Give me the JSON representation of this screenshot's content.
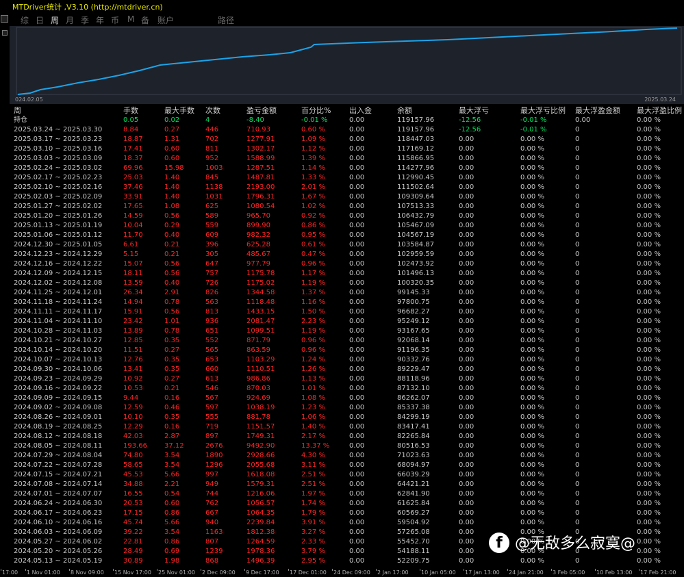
{
  "app": {
    "title": "MTDriver统计 ,V3.10 (http://mtdriver.cn)"
  },
  "tabs": [
    {
      "label": "综"
    },
    {
      "label": "日"
    },
    {
      "label": "周",
      "active": true
    },
    {
      "label": "月"
    },
    {
      "label": "季"
    },
    {
      "label": "年"
    },
    {
      "label": "币"
    },
    {
      "label": "M"
    },
    {
      "label": "备"
    },
    {
      "label": "账户"
    },
    {
      "label": "路径"
    }
  ],
  "chart": {
    "start_label": "024.02.05",
    "end_label": "2025.03.24",
    "line_color": "#1ca3e8",
    "background": "#1e222b"
  },
  "colors": {
    "green": "#00e060",
    "red": "#ff2424",
    "header": "#d0d0d0",
    "text": "#c8c8c8"
  },
  "table": {
    "headers": [
      "周",
      "手数",
      "最大手数",
      "次数",
      "盈亏金额",
      "百分比%",
      "出入金",
      "余额",
      "最大浮亏",
      "最大浮亏比例",
      "最大浮盈金额",
      "最大浮盈比例"
    ],
    "position_row": [
      "持仓",
      "0.05",
      "0.02",
      "4",
      "-8.40",
      "-0.01 %",
      "0.00",
      "119157.96",
      "-12.56",
      "-0.01 %",
      "0.00",
      "0.00 %"
    ],
    "rows": [
      [
        "2025.03.24 ~ 2025.03.30",
        "8.84",
        "0.27",
        "446",
        "710.93",
        "0.60 %",
        "0.00",
        "119157.96",
        "-12.56",
        "-0.01 %",
        "0",
        "0.00 %"
      ],
      [
        "2025.03.17 ~ 2025.03.23",
        "18.87",
        "1.31",
        "702",
        "1277.91",
        "1.09 %",
        "0.00",
        "118447.03",
        "0.00",
        "0.00 %",
        "0",
        "0.00 %"
      ],
      [
        "2025.03.10 ~ 2025.03.16",
        "17.41",
        "0.60",
        "811",
        "1302.17",
        "1.12 %",
        "0.00",
        "117169.12",
        "0.00",
        "0.00 %",
        "0",
        "0.00 %"
      ],
      [
        "2025.03.03 ~ 2025.03.09",
        "18.37",
        "0.60",
        "952",
        "1588.99",
        "1.39 %",
        "0.00",
        "115866.95",
        "0.00",
        "0.00 %",
        "0",
        "0.00 %"
      ],
      [
        "2025.02.24 ~ 2025.03.02",
        "69.96",
        "15.98",
        "1003",
        "1287.51",
        "1.14 %",
        "0.00",
        "114277.96",
        "0.00",
        "0.00 %",
        "0",
        "0.00 %"
      ],
      [
        "2025.02.17 ~ 2025.02.23",
        "25.03",
        "1.40",
        "845",
        "1487.81",
        "1.33 %",
        "0.00",
        "112990.45",
        "0.00",
        "0.00 %",
        "0",
        "0.00 %"
      ],
      [
        "2025.02.10 ~ 2025.02.16",
        "37.46",
        "1.40",
        "1138",
        "2193.00",
        "2.01 %",
        "0.00",
        "111502.64",
        "0.00",
        "0.00 %",
        "0",
        "0.00 %"
      ],
      [
        "2025.02.03 ~ 2025.02.09",
        "33.91",
        "1.40",
        "1031",
        "1796.31",
        "1.67 %",
        "0.00",
        "109309.64",
        "0.00",
        "0.00 %",
        "0",
        "0.00 %"
      ],
      [
        "2025.01.27 ~ 2025.02.02",
        "17.65",
        "1.08",
        "625",
        "1080.54",
        "1.02 %",
        "0.00",
        "107513.33",
        "0.00",
        "0.00 %",
        "0",
        "0.00 %"
      ],
      [
        "2025.01.20 ~ 2025.01.26",
        "14.59",
        "0.56",
        "589",
        "965.70",
        "0.92 %",
        "0.00",
        "106432.79",
        "0.00",
        "0.00 %",
        "0",
        "0.00 %"
      ],
      [
        "2025.01.13 ~ 2025.01.19",
        "10.04",
        "0.29",
        "559",
        "899.90",
        "0.86 %",
        "0.00",
        "105467.09",
        "0.00",
        "0.00 %",
        "0",
        "0.00 %"
      ],
      [
        "2025.01.06 ~ 2025.01.12",
        "11.70",
        "0.40",
        "609",
        "982.32",
        "0.95 %",
        "0.00",
        "104567.19",
        "0.00",
        "0.00 %",
        "0",
        "0.00 %"
      ],
      [
        "2024.12.30 ~ 2025.01.05",
        "6.61",
        "0.21",
        "396",
        "625.28",
        "0.61 %",
        "0.00",
        "103584.87",
        "0.00",
        "0.00 %",
        "0",
        "0.00 %"
      ],
      [
        "2024.12.23 ~ 2024.12.29",
        "5.15",
        "0.21",
        "305",
        "485.67",
        "0.47 %",
        "0.00",
        "102959.59",
        "0.00",
        "0.00 %",
        "0",
        "0.00 %"
      ],
      [
        "2024.12.16 ~ 2024.12.22",
        "15.07",
        "0.56",
        "647",
        "977.79",
        "0.96 %",
        "0.00",
        "102473.92",
        "0.00",
        "0.00 %",
        "0",
        "0.00 %"
      ],
      [
        "2024.12.09 ~ 2024.12.15",
        "18.11",
        "0.56",
        "757",
        "1175.78",
        "1.17 %",
        "0.00",
        "101496.13",
        "0.00",
        "0.00 %",
        "0",
        "0.00 %"
      ],
      [
        "2024.12.02 ~ 2024.12.08",
        "13.59",
        "0.40",
        "726",
        "1175.02",
        "1.19 %",
        "0.00",
        "100320.35",
        "0.00",
        "0.00 %",
        "0",
        "0.00 %"
      ],
      [
        "2024.11.25 ~ 2024.12.01",
        "26.34",
        "2.91",
        "826",
        "1344.58",
        "1.37 %",
        "0.00",
        "99145.33",
        "0.00",
        "0.00 %",
        "0",
        "0.00 %"
      ],
      [
        "2024.11.18 ~ 2024.11.24",
        "14.94",
        "0.78",
        "563",
        "1118.48",
        "1.16 %",
        "0.00",
        "97800.75",
        "0.00",
        "0.00 %",
        "0",
        "0.00 %"
      ],
      [
        "2024.11.11 ~ 2024.11.17",
        "15.91",
        "0.56",
        "813",
        "1433.15",
        "1.50 %",
        "0.00",
        "96682.27",
        "0.00",
        "0.00 %",
        "0",
        "0.00 %"
      ],
      [
        "2024.11.04 ~ 2024.11.10",
        "23.42",
        "1.01",
        "936",
        "2081.47",
        "2.23 %",
        "0.00",
        "95249.12",
        "0.00",
        "0.00 %",
        "0",
        "0.00 %"
      ],
      [
        "2024.10.28 ~ 2024.11.03",
        "13.89",
        "0.78",
        "651",
        "1099.51",
        "1.19 %",
        "0.00",
        "93167.65",
        "0.00",
        "0.00 %",
        "0",
        "0.00 %"
      ],
      [
        "2024.10.21 ~ 2024.10.27",
        "12.85",
        "0.35",
        "552",
        "871.79",
        "0.96 %",
        "0.00",
        "92068.14",
        "0.00",
        "0.00 %",
        "0",
        "0.00 %"
      ],
      [
        "2024.10.14 ~ 2024.10.20",
        "11.51",
        "0.27",
        "565",
        "863.59",
        "0.96 %",
        "0.00",
        "91196.35",
        "0.00",
        "0.00 %",
        "0",
        "0.00 %"
      ],
      [
        "2024.10.07 ~ 2024.10.13",
        "12.76",
        "0.35",
        "653",
        "1103.29",
        "1.24 %",
        "0.00",
        "90332.76",
        "0.00",
        "0.00 %",
        "0",
        "0.00 %"
      ],
      [
        "2024.09.30 ~ 2024.10.06",
        "13.41",
        "0.35",
        "660",
        "1110.51",
        "1.26 %",
        "0.00",
        "89229.47",
        "0.00",
        "0.00 %",
        "0",
        "0.00 %"
      ],
      [
        "2024.09.23 ~ 2024.09.29",
        "10.92",
        "0.27",
        "613",
        "986.86",
        "1.13 %",
        "0.00",
        "88118.96",
        "0.00",
        "0.00 %",
        "0",
        "0.00 %"
      ],
      [
        "2024.09.16 ~ 2024.09.22",
        "10.53",
        "0.21",
        "546",
        "870.03",
        "1.01 %",
        "0.00",
        "87132.10",
        "0.00",
        "0.00 %",
        "0",
        "0.00 %"
      ],
      [
        "2024.09.09 ~ 2024.09.15",
        "9.44",
        "0.16",
        "567",
        "924.69",
        "1.08 %",
        "0.00",
        "86262.07",
        "0.00",
        "0.00 %",
        "0",
        "0.00 %"
      ],
      [
        "2024.09.02 ~ 2024.09.08",
        "12.59",
        "0.46",
        "597",
        "1038.19",
        "1.23 %",
        "0.00",
        "85337.38",
        "0.00",
        "0.00 %",
        "0",
        "0.00 %"
      ],
      [
        "2024.08.26 ~ 2024.09.01",
        "10.10",
        "0.35",
        "555",
        "881.78",
        "1.06 %",
        "0.00",
        "84299.19",
        "0.00",
        "0.00 %",
        "0",
        "0.00 %"
      ],
      [
        "2024.08.19 ~ 2024.08.25",
        "12.29",
        "0.16",
        "719",
        "1151.57",
        "1.40 %",
        "0.00",
        "83417.41",
        "0.00",
        "0.00 %",
        "0",
        "0.00 %"
      ],
      [
        "2024.08.12 ~ 2024.08.18",
        "42.03",
        "2.87",
        "897",
        "1749.31",
        "2.17 %",
        "0.00",
        "82265.84",
        "0.00",
        "0.00 %",
        "0",
        "0.00 %"
      ],
      [
        "2024.08.05 ~ 2024.08.11",
        "193.66",
        "37.12",
        "2676",
        "9492.90",
        "13.37 %",
        "0.00",
        "80516.53",
        "0.00",
        "0.00 %",
        "0",
        "0.00 %"
      ],
      [
        "2024.07.29 ~ 2024.08.04",
        "74.80",
        "3.54",
        "1890",
        "2928.66",
        "4.30 %",
        "0.00",
        "71023.63",
        "0.00",
        "0.00 %",
        "0",
        "0.00 %"
      ],
      [
        "2024.07.22 ~ 2024.07.28",
        "58.65",
        "3.54",
        "1296",
        "2055.68",
        "3.11 %",
        "0.00",
        "68094.97",
        "0.00",
        "0.00 %",
        "0",
        "0.00 %"
      ],
      [
        "2024.07.15 ~ 2024.07.21",
        "45.53",
        "5.66",
        "997",
        "1618.08",
        "2.51 %",
        "0.00",
        "66039.29",
        "0.00",
        "0.00 %",
        "0",
        "0.00 %"
      ],
      [
        "2024.07.08 ~ 2024.07.14",
        "34.88",
        "2.21",
        "949",
        "1579.31",
        "2.51 %",
        "0.00",
        "64421.21",
        "0.00",
        "0.00 %",
        "0",
        "0.00 %"
      ],
      [
        "2024.07.01 ~ 2024.07.07",
        "16.55",
        "0.54",
        "744",
        "1216.06",
        "1.97 %",
        "0.00",
        "62841.90",
        "0.00",
        "0.00 %",
        "0",
        "0.00 %"
      ],
      [
        "2024.06.24 ~ 2024.06.30",
        "20.53",
        "0.60",
        "762",
        "1056.57",
        "1.74 %",
        "0.00",
        "61625.84",
        "0.00",
        "0.00 %",
        "0",
        "0.00 %"
      ],
      [
        "2024.06.17 ~ 2024.06.23",
        "17.15",
        "0.86",
        "667",
        "1064.35",
        "1.79 %",
        "0.00",
        "60569.27",
        "0.00",
        "0.00 %",
        "0",
        "0.00 %"
      ],
      [
        "2024.06.10 ~ 2024.06.16",
        "45.74",
        "5.66",
        "940",
        "2239.84",
        "3.91 %",
        "0.00",
        "59504.92",
        "0.00",
        "0.00 %",
        "0",
        "0.00 %"
      ],
      [
        "2024.06.03 ~ 2024.06.09",
        "39.22",
        "3.54",
        "1163",
        "1812.38",
        "3.27 %",
        "0.00",
        "57265.08",
        "0.00",
        "0.00 %",
        "0",
        "0.00 %"
      ],
      [
        "2024.05.27 ~ 2024.06.02",
        "22.81",
        "0.86",
        "807",
        "1264.59",
        "2.33 %",
        "0.00",
        "55452.70",
        "0.00",
        "0.00 %",
        "0",
        "0.00 %"
      ],
      [
        "2024.05.20 ~ 2024.05.26",
        "28.49",
        "0.69",
        "1239",
        "1978.36",
        "3.79 %",
        "0.00",
        "54188.11",
        "0.00",
        "0.00 %",
        "0",
        "0.00 %"
      ],
      [
        "2024.05.13 ~ 2024.05.19",
        "30.89",
        "1.98",
        "868",
        "1496.39",
        "2.95 %",
        "0.00",
        "52209.75",
        "0.00",
        "0.00 %",
        "0",
        "0.00 %"
      ]
    ]
  },
  "bottom_axis": {
    "labels": [
      "17:00",
      "1 Nov 01:00",
      "8 Nov 09:00",
      "15 Nov 17:00",
      "25 Nov 01:00",
      "2 Dec 09:00",
      "9 Dec 17:00",
      "17 Dec 01:00",
      "24 Dec 09:00",
      "2 Jan 17:00",
      "10 Jan 05:00",
      "17 Jan 13:00",
      "24 Jan 21:00",
      "3 Feb 05:00",
      "10 Feb 13:00",
      "17 Feb 21:00"
    ]
  },
  "watermark": {
    "logo_letter": "f",
    "text": "@无敌多么寂寞@"
  }
}
